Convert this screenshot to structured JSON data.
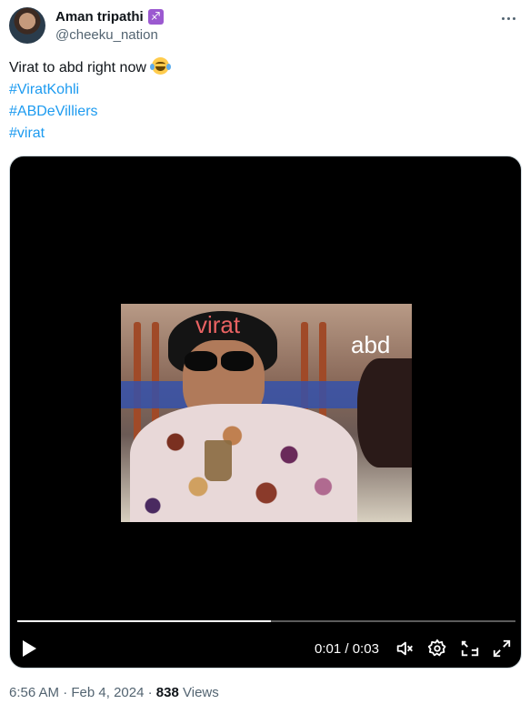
{
  "author": {
    "display_name": "Aman tripathi",
    "handle": "@cheeku_nation",
    "badge_glyph": "♐",
    "badge_color": "#9b59d0"
  },
  "tweet": {
    "text": "Virat to abd right now",
    "emoji": "face-with-tears-of-joy",
    "hashtags": [
      "#ViratKohli",
      "#ABDeVilliers",
      "#virat"
    ]
  },
  "video": {
    "overlay_labels": [
      "virat",
      "abd"
    ],
    "current_time": "0:01",
    "separator": "/",
    "duration": "0:03",
    "progress_fraction": 0.51,
    "controls": [
      "play-icon",
      "mute-icon",
      "settings-icon",
      "pip-icon",
      "fullscreen-icon"
    ]
  },
  "meta": {
    "time": "6:56 AM",
    "dot": "·",
    "date": "Feb 4, 2024",
    "views_count": "838",
    "views_label": "Views"
  },
  "colors": {
    "hashtag": "#1d9bf0",
    "secondary_text": "#536471",
    "primary_text": "#0f1419"
  }
}
